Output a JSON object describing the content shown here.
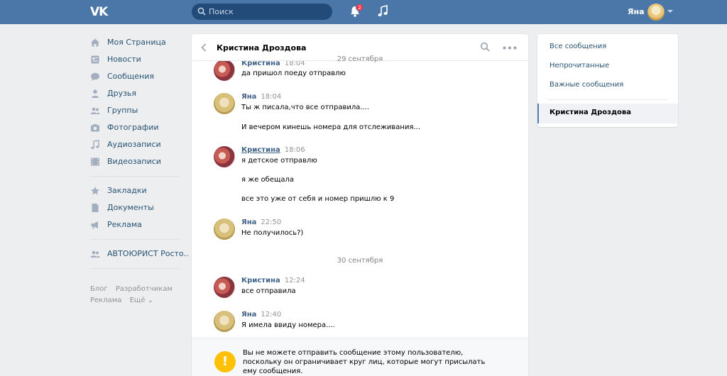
{
  "header": {
    "logo": "VK",
    "search_placeholder": "Поиск",
    "notifications_count": "2",
    "user_name": "Яна"
  },
  "nav": {
    "items": [
      {
        "label": "Моя Страница",
        "icon": "home-icon"
      },
      {
        "label": "Новости",
        "icon": "news-icon"
      },
      {
        "label": "Сообщения",
        "icon": "messages-icon"
      },
      {
        "label": "Друзья",
        "icon": "friends-icon"
      },
      {
        "label": "Группы",
        "icon": "groups-icon"
      },
      {
        "label": "Фотографии",
        "icon": "camera-icon"
      },
      {
        "label": "Аудиозаписи",
        "icon": "music-note-icon"
      },
      {
        "label": "Видеозаписи",
        "icon": "film-icon"
      }
    ],
    "items2": [
      {
        "label": "Закладки",
        "icon": "star-icon"
      },
      {
        "label": "Документы",
        "icon": "document-icon"
      },
      {
        "label": "Реклама",
        "icon": "megaphone-icon"
      }
    ],
    "items3": [
      {
        "label": "АВТОЮРИСТ Росто..",
        "icon": "community-icon"
      }
    ],
    "footer": {
      "blog": "Блог",
      "developers": "Разработчикам",
      "ads": "Реклама",
      "more": "Ещё ⌄"
    }
  },
  "chat": {
    "title": "Кристина Дроздова",
    "date1": "29 сентября",
    "date2": "30 сентября",
    "messages": [
      {
        "author": "Кристина",
        "time": "18:04",
        "lines": [
          "да пришол поеду отправлю"
        ]
      },
      {
        "author": "Яна",
        "time": "18:04",
        "lines": [
          "Ты ж писала,что все отправила....",
          "И вечером кинешь номера для отслеживания..."
        ]
      },
      {
        "author": "Кристина",
        "time": "18:06",
        "lines": [
          "я детское отправлю",
          "я же обещала",
          "все это уже от себя и номер пришлю к 9"
        ]
      },
      {
        "author": "Яна",
        "time": "22:50",
        "lines": [
          "Не получилось?)"
        ]
      },
      {
        "author": "Кристина",
        "time": "12:24",
        "lines": [
          "все отправила"
        ]
      },
      {
        "author": "Яна",
        "time": "12:40",
        "lines": [
          "Я имела ввиду номера...."
        ]
      }
    ],
    "notice": "Вы не можете отправить сообщение этому пользователю, поскольку он ограничивает круг лиц, которые могут присылать ему сообщения."
  },
  "filters": {
    "all": "Все сообщения",
    "unread": "Непрочитанные",
    "important": "Важные сообщения",
    "active": "Кристина Дроздова"
  },
  "colors": {
    "header": "#4a76a8",
    "link": "#285473",
    "author": "#42648b",
    "warning": "#ffc107"
  }
}
